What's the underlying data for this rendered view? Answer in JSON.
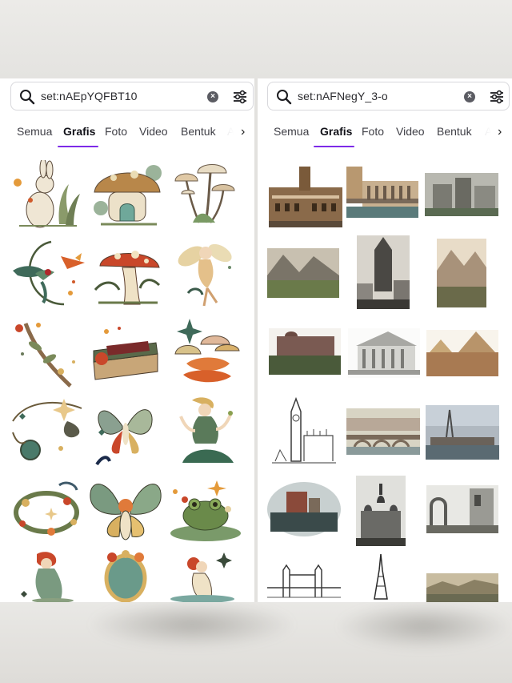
{
  "panels": [
    {
      "search": {
        "query": "set:nAEpYQFBT10"
      },
      "tabs": [
        {
          "label": "Semua",
          "active": false
        },
        {
          "label": "Grafis",
          "active": true
        },
        {
          "label": "Foto",
          "active": false
        },
        {
          "label": "Video",
          "active": false
        },
        {
          "label": "Bentuk",
          "active": false
        },
        {
          "label": "Au",
          "active": false
        }
      ],
      "grid": [
        "rabbit-graphic",
        "mushroom-house-graphic",
        "mushrooms-graphic",
        "hummingbird-graphic",
        "red-mushroom-graphic",
        "fairy-graphic",
        "branch-graphic",
        "book-graphic",
        "orange-mushrooms-graphic",
        "pocket-watch-graphic",
        "butterfly-fairy-graphic",
        "sitting-woman-graphic",
        "floral-wreath-graphic",
        "butterfly-woman-graphic",
        "frog-graphic",
        "mermaid-graphic",
        "mirror-graphic",
        "bathing-woman-graphic"
      ]
    },
    {
      "search": {
        "query": "set:nAFNegY_3-o"
      },
      "tabs": [
        {
          "label": "Semua",
          "active": false
        },
        {
          "label": "Grafis",
          "active": true
        },
        {
          "label": "Foto",
          "active": false
        },
        {
          "label": "Video",
          "active": false
        },
        {
          "label": "Bentuk",
          "active": false
        },
        {
          "label": "A",
          "active": false
        }
      ],
      "grid": [
        "city-hall-photo",
        "venice-palace-photo",
        "castle-photo",
        "mountain-valley-photo",
        "gothic-tower-photo",
        "alps-photo",
        "manor-house-photo",
        "classical-building-photo",
        "pyramids-photo",
        "big-ben-sketch",
        "bridge-river-photo",
        "harbor-photo",
        "island-castle-photo",
        "saint-basil-photo",
        "ruins-photo",
        "tower-bridge-sketch",
        "eiffel-tower-sketch",
        "panorama-photo"
      ]
    }
  ],
  "colors": {
    "accent": "#7d2ae8",
    "search_border": "#d8d8dc",
    "text": "#2b2b2f"
  }
}
